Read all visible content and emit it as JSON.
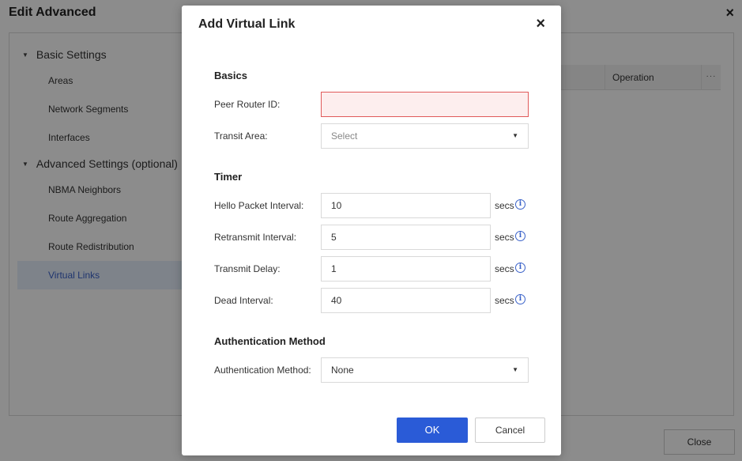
{
  "background": {
    "title": "Edit Advanced",
    "close_icon": "×",
    "tree": {
      "basic_group": "Basic Settings",
      "basic_items": [
        "Areas",
        "Network Segments",
        "Interfaces"
      ],
      "advanced_group": "Advanced Settings (optional)",
      "advanced_items": [
        "NBMA Neighbors",
        "Route Aggregation",
        "Route Redistribution",
        "Virtual Links"
      ],
      "active_item": "Virtual Links"
    },
    "table": {
      "operation_header": "Operation",
      "more_icon": "···"
    },
    "close_button": "Close"
  },
  "modal": {
    "title": "Add Virtual Link",
    "close_icon": "×",
    "basics": {
      "section": "Basics",
      "peer_router_id_label": "Peer Router ID:",
      "peer_router_id_value": "",
      "transit_area_label": "Transit Area:",
      "transit_area_placeholder": "Select"
    },
    "timer": {
      "section": "Timer",
      "hello_label": "Hello Packet Interval:",
      "hello_value": "10",
      "retransmit_label": "Retransmit Interval:",
      "retransmit_value": "5",
      "transmit_delay_label": "Transmit Delay:",
      "transmit_delay_value": "1",
      "dead_label": "Dead Interval:",
      "dead_value": "40",
      "unit": "secs",
      "info_glyph": "i"
    },
    "auth": {
      "section": "Authentication Method",
      "method_label": "Authentication Method:",
      "method_value": "None"
    },
    "ok_button": "OK",
    "cancel_button": "Cancel"
  },
  "colors": {
    "primary": "#2a5bd7",
    "error_border": "#e05a5a",
    "error_fill": "#fdeeee",
    "active_item_bg": "#e6eefc"
  }
}
